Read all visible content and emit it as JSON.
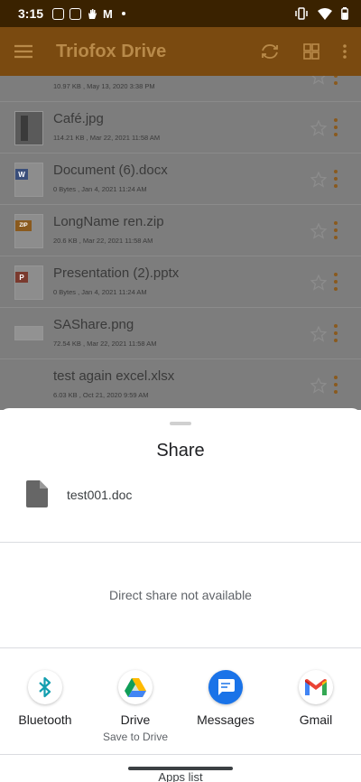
{
  "status_bar": {
    "time": "3:15",
    "notification_icons": [
      "whatsapp-icon",
      "whatsapp-icon",
      "hand-icon",
      "gmail-icon",
      "dot-icon"
    ],
    "system_icons": [
      "vibrate-icon",
      "wifi-icon",
      "battery-icon"
    ]
  },
  "app_bar": {
    "title": "Triofox Drive"
  },
  "files": [
    {
      "name": "",
      "meta": "10.97 KB , May 13, 2020 3:38 PM",
      "icon": "image-thumb-icon"
    },
    {
      "name": "Café.jpg",
      "meta": "114.21 KB , Mar 22, 2021 11:58 AM",
      "icon": "photo-thumb-icon"
    },
    {
      "name": "Document (6).docx",
      "meta": "0 Bytes , Jan 4, 2021 11:24 AM",
      "icon": "word-file-icon",
      "badge": "W"
    },
    {
      "name": "LongName ren.zip",
      "meta": "20.6 KB , Mar 22, 2021 11:58 AM",
      "icon": "zip-file-icon",
      "badge": "ZIP"
    },
    {
      "name": "Presentation (2).pptx",
      "meta": "0 Bytes , Jan 4, 2021 11:24 AM",
      "icon": "powerpoint-file-icon",
      "badge": "P"
    },
    {
      "name": "SAShare.png",
      "meta": "72.54 KB , Mar 22, 2021 11:58 AM",
      "icon": "image-thumb-icon"
    },
    {
      "name": "test again excel.xlsx",
      "meta": "6.03 KB , Oct 21, 2020 9:59 AM",
      "icon": "excel-file-icon"
    }
  ],
  "share_sheet": {
    "title": "Share",
    "file_name": "test001.doc",
    "direct_share_text": "Direct share not available",
    "apps": [
      {
        "label": "Bluetooth",
        "sublabel": "",
        "icon": "bluetooth-icon"
      },
      {
        "label": "Drive",
        "sublabel": "Save to Drive",
        "icon": "google-drive-icon"
      },
      {
        "label": "Messages",
        "sublabel": "",
        "icon": "messages-icon"
      },
      {
        "label": "Gmail",
        "sublabel": "",
        "icon": "gmail-icon"
      }
    ],
    "apps_list_label": "Apps list"
  },
  "colors": {
    "status_bar": "#3a2200",
    "app_bar_dimmed": "#7a4a10",
    "accent": "#e08a1a",
    "messages_blue": "#1a73e8",
    "bluetooth_teal": "#129eaf"
  }
}
